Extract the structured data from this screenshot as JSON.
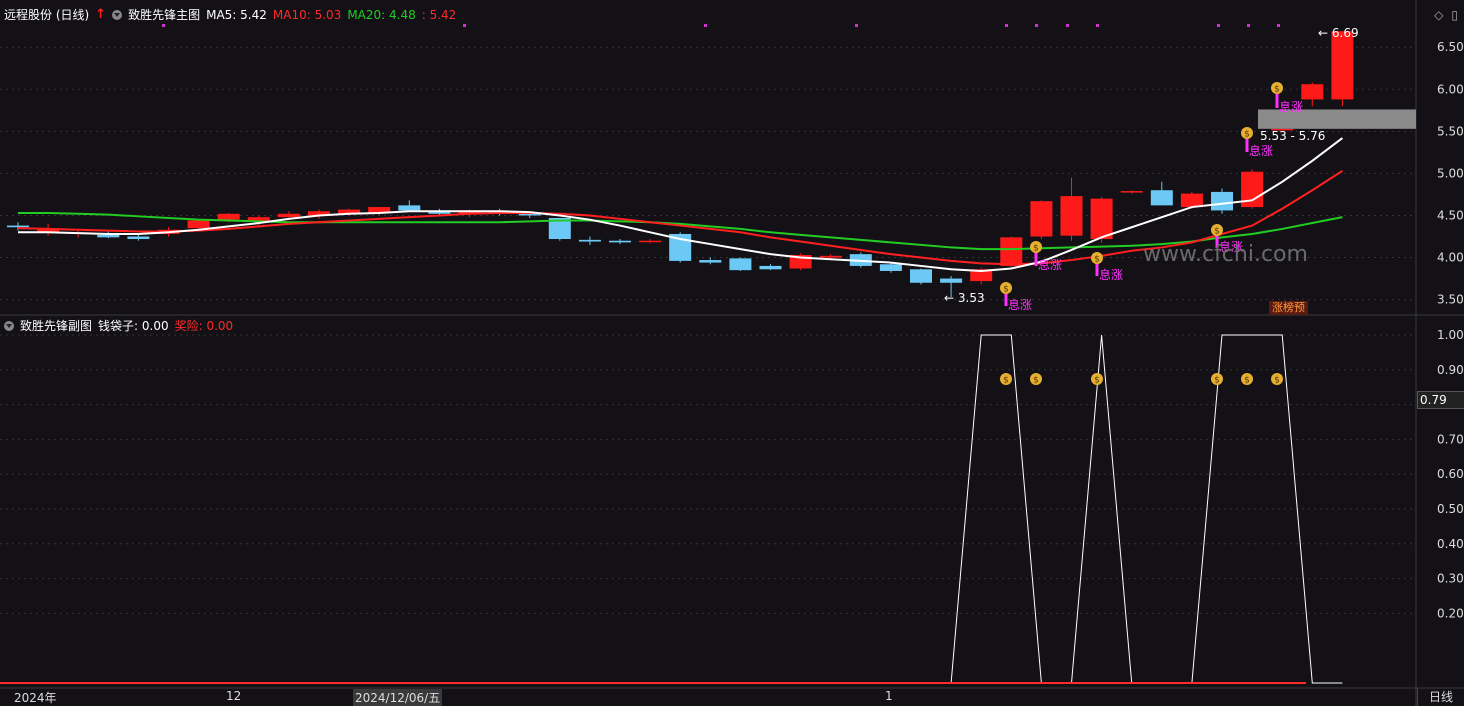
{
  "main_header": {
    "stock": "远程股份 (日线)",
    "indicator": "致胜先锋主图",
    "ma5": "MA5: 5.42",
    "ma10": "MA10: 5.03",
    "ma20": "MA20: 4.48",
    "extra": ": 5.42"
  },
  "sub_header": {
    "indicator": "致胜先锋副图",
    "moneybag": "钱袋子: 0.00",
    "risk": "奖险: 0.00"
  },
  "colors": {
    "up": "#ff1a1a",
    "down": "#6cc8f5",
    "ma5": "#ffffff",
    "ma10": "#ff2020",
    "ma20": "#22cc22",
    "label_magenta": "#ff30ff"
  },
  "price_axis": [
    "6.50",
    "6.00",
    "5.50",
    "5.00",
    "4.50",
    "4.00",
    "3.50"
  ],
  "sub_axis": [
    "1.00",
    "0.90",
    "0.80",
    "0.70",
    "0.60",
    "0.50",
    "0.40",
    "0.30",
    "0.20"
  ],
  "sub_current": "0.79",
  "annotations": {
    "high": "6.69",
    "low": "3.53",
    "range": "5.53 - 5.76",
    "watermark": "www.cfchi.com",
    "tag": "涨榜预",
    "rise": "息涨"
  },
  "date_axis": {
    "year": "2024年",
    "m12": "12",
    "cursor_date": "2024/12/06/五",
    "m1": "1",
    "period_button": "日线"
  },
  "chart_data": {
    "type": "candlestick",
    "ylim": [
      3.4,
      6.8
    ],
    "candles": [
      [
        4.38,
        4.42,
        4.32,
        4.36
      ],
      [
        4.3,
        4.4,
        4.26,
        4.35
      ],
      [
        4.28,
        4.33,
        4.24,
        4.3
      ],
      [
        4.27,
        4.32,
        4.23,
        4.24
      ],
      [
        4.25,
        4.28,
        4.2,
        4.22
      ],
      [
        4.28,
        4.36,
        4.25,
        4.33
      ],
      [
        4.35,
        4.46,
        4.32,
        4.44
      ],
      [
        4.45,
        4.53,
        4.42,
        4.52
      ],
      [
        4.44,
        4.5,
        4.38,
        4.48
      ],
      [
        4.48,
        4.55,
        4.45,
        4.52
      ],
      [
        4.5,
        4.57,
        4.46,
        4.55
      ],
      [
        4.52,
        4.58,
        4.5,
        4.57
      ],
      [
        4.53,
        4.6,
        4.5,
        4.6
      ],
      [
        4.62,
        4.68,
        4.55,
        4.56
      ],
      [
        4.55,
        4.58,
        4.5,
        4.52
      ],
      [
        4.52,
        4.57,
        4.48,
        4.56
      ],
      [
        4.55,
        4.58,
        4.5,
        4.52
      ],
      [
        4.52,
        4.53,
        4.47,
        4.5
      ],
      [
        4.47,
        4.47,
        4.2,
        4.22
      ],
      [
        4.21,
        4.25,
        4.15,
        4.19
      ],
      [
        4.2,
        4.22,
        4.16,
        4.18
      ],
      [
        4.19,
        4.22,
        4.17,
        4.2
      ],
      [
        4.28,
        4.3,
        3.94,
        3.96
      ],
      [
        3.97,
        4.0,
        3.92,
        3.94
      ],
      [
        3.99,
        4.0,
        3.84,
        3.85
      ],
      [
        3.9,
        3.92,
        3.85,
        3.86
      ],
      [
        3.87,
        4.05,
        3.85,
        4.03
      ],
      [
        4.0,
        4.04,
        3.98,
        4.02
      ],
      [
        4.04,
        4.06,
        3.88,
        3.9
      ],
      [
        3.92,
        3.94,
        3.82,
        3.84
      ],
      [
        3.86,
        3.87,
        3.68,
        3.7
      ],
      [
        3.75,
        3.78,
        3.53,
        3.7
      ],
      [
        3.72,
        3.88,
        3.68,
        3.86
      ],
      [
        3.9,
        4.25,
        3.88,
        4.24
      ],
      [
        4.25,
        4.68,
        4.22,
        4.67
      ],
      [
        4.26,
        4.95,
        4.2,
        4.73
      ],
      [
        4.22,
        4.72,
        4.18,
        4.7
      ],
      [
        4.78,
        4.8,
        4.76,
        4.79
      ],
      [
        4.8,
        4.9,
        4.7,
        4.62
      ],
      [
        4.6,
        4.78,
        4.58,
        4.76
      ],
      [
        4.78,
        4.82,
        4.52,
        4.56
      ],
      [
        4.6,
        5.05,
        4.58,
        5.02
      ],
      [
        5.53,
        5.76,
        5.5,
        5.53
      ],
      [
        5.88,
        6.08,
        5.8,
        6.06
      ],
      [
        5.88,
        6.69,
        5.8,
        6.69
      ]
    ],
    "ma5": [
      4.3,
      4.3,
      4.29,
      4.28,
      4.28,
      4.3,
      4.33,
      4.37,
      4.41,
      4.46,
      4.5,
      4.52,
      4.53,
      4.55,
      4.55,
      4.55,
      4.55,
      4.54,
      4.5,
      4.45,
      4.38,
      4.3,
      4.22,
      4.16,
      4.1,
      4.04,
      4.0,
      3.98,
      3.96,
      3.94,
      3.9,
      3.86,
      3.84,
      3.87,
      3.95,
      4.09,
      4.24,
      4.36,
      4.48,
      4.6,
      4.64,
      4.68,
      4.9,
      5.15,
      5.42
    ],
    "ma10": [
      4.35,
      4.34,
      4.33,
      4.32,
      4.31,
      4.31,
      4.32,
      4.34,
      4.37,
      4.4,
      4.42,
      4.44,
      4.46,
      4.48,
      4.5,
      4.52,
      4.53,
      4.53,
      4.52,
      4.5,
      4.46,
      4.42,
      4.38,
      4.34,
      4.3,
      4.24,
      4.19,
      4.14,
      4.09,
      4.04,
      4.0,
      3.96,
      3.93,
      3.92,
      3.93,
      3.97,
      4.02,
      4.08,
      4.12,
      4.18,
      4.28,
      4.38,
      4.58,
      4.8,
      5.03
    ],
    "ma20": [
      4.53,
      4.53,
      4.52,
      4.51,
      4.49,
      4.47,
      4.45,
      4.44,
      4.43,
      4.42,
      4.42,
      4.42,
      4.42,
      4.42,
      4.42,
      4.42,
      4.42,
      4.43,
      4.44,
      4.44,
      4.43,
      4.42,
      4.4,
      4.37,
      4.34,
      4.3,
      4.27,
      4.24,
      4.21,
      4.18,
      4.15,
      4.12,
      4.1,
      4.1,
      4.11,
      4.12,
      4.13,
      4.14,
      4.16,
      4.19,
      4.24,
      4.28,
      4.34,
      4.41,
      4.48
    ],
    "sub_series": [
      0,
      0,
      0,
      0,
      0,
      0,
      0,
      0,
      0,
      0,
      0,
      0,
      0,
      0,
      0,
      0,
      0,
      0,
      0,
      0,
      0,
      0,
      0,
      0,
      0,
      0,
      0,
      0,
      0,
      0,
      0,
      0,
      1,
      1,
      0,
      0,
      1,
      0,
      0,
      0,
      1,
      1,
      1,
      0,
      0
    ]
  }
}
